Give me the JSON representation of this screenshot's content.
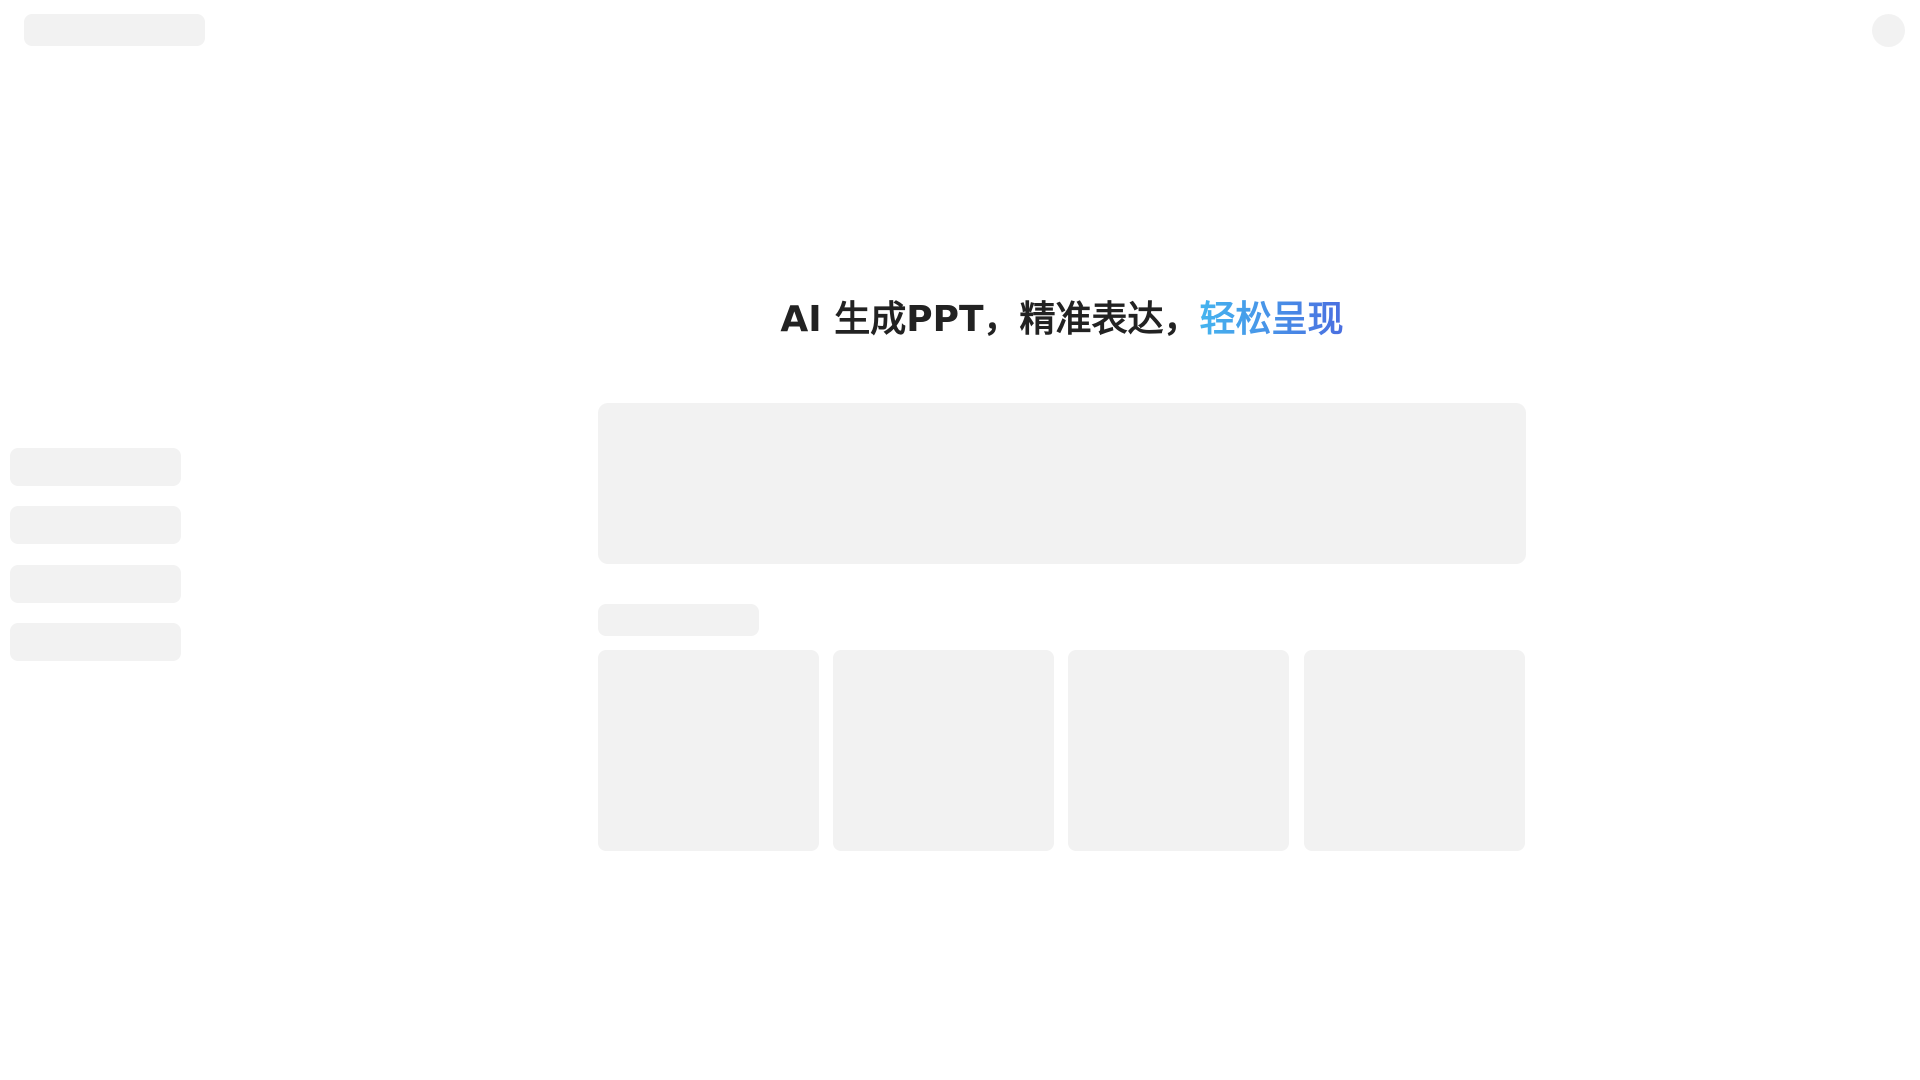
{
  "hero": {
    "title_main": "AI 生成PPT，精准表达，",
    "title_accent": "轻松呈现"
  },
  "colors": {
    "skeleton": "#f2f2f2",
    "title_text": "#222222",
    "accent_gradient_start": "#45b4ef",
    "accent_gradient_end": "#4a6ee0"
  }
}
